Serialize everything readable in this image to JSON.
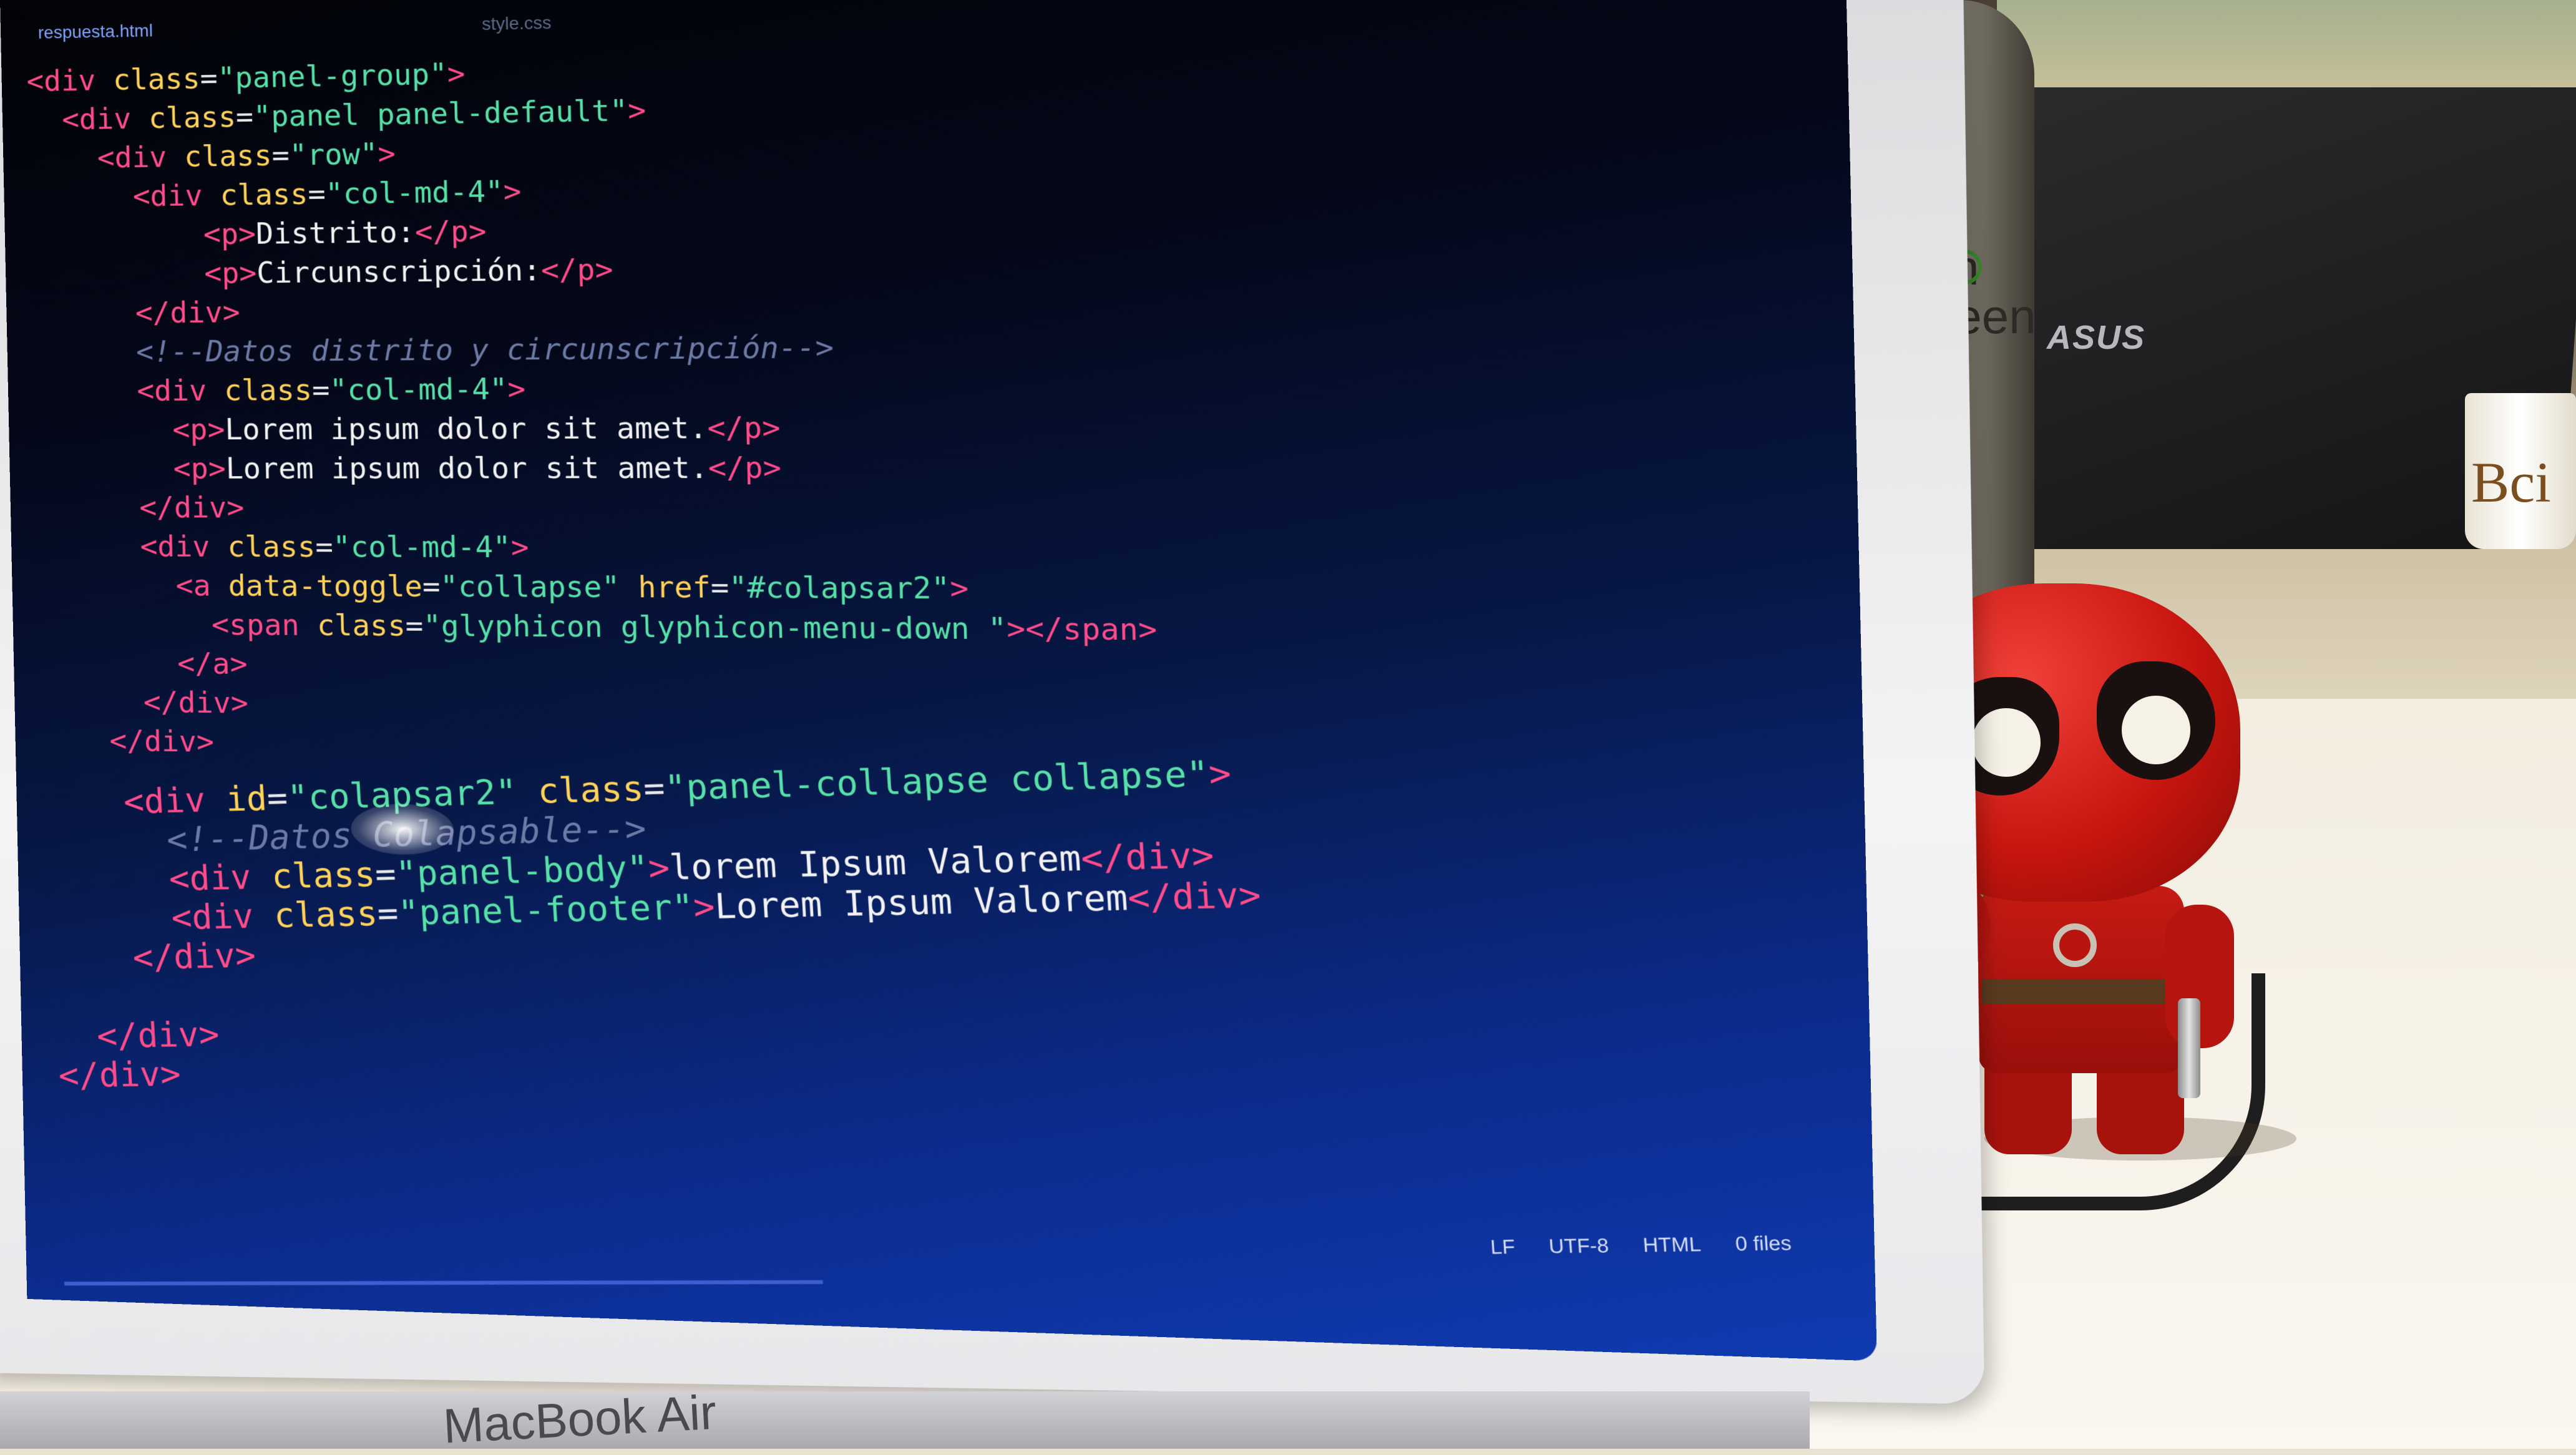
{
  "editor": {
    "tabs": [
      "respuesta.html",
      "style.css"
    ],
    "code_lines_upper": [
      {
        "indent": "",
        "parts": [
          [
            "tag",
            "<div "
          ],
          [
            "attr",
            "class"
          ],
          [
            "punct",
            "="
          ],
          [
            "str",
            "\"panel-group\""
          ],
          [
            "tag",
            ">"
          ]
        ]
      },
      {
        "indent": "  ",
        "parts": [
          [
            "tag",
            "<div "
          ],
          [
            "attr",
            "class"
          ],
          [
            "punct",
            "="
          ],
          [
            "str",
            "\"panel panel-default\""
          ],
          [
            "tag",
            ">"
          ]
        ]
      },
      {
        "indent": "    ",
        "parts": [
          [
            "tag",
            "<div "
          ],
          [
            "attr",
            "class"
          ],
          [
            "punct",
            "="
          ],
          [
            "str",
            "\"row\""
          ],
          [
            "tag",
            ">"
          ]
        ]
      },
      {
        "indent": "      ",
        "parts": [
          [
            "tag",
            "<div "
          ],
          [
            "attr",
            "class"
          ],
          [
            "punct",
            "="
          ],
          [
            "str",
            "\"col-md-4\""
          ],
          [
            "tag",
            ">"
          ]
        ]
      },
      {
        "indent": "          ",
        "parts": [
          [
            "tag",
            "<p>"
          ],
          [
            "txt",
            "Distrito:"
          ],
          [
            "tag",
            "</p>"
          ]
        ]
      },
      {
        "indent": "          ",
        "parts": [
          [
            "tag",
            "<p>"
          ],
          [
            "txt",
            "Circunscripción:"
          ],
          [
            "tag",
            "</p>"
          ]
        ]
      },
      {
        "indent": "      ",
        "parts": [
          [
            "tag",
            "</div>"
          ]
        ]
      },
      {
        "indent": "      ",
        "parts": [
          [
            "comment",
            "<!--Datos distrito y circunscripción-->"
          ]
        ]
      },
      {
        "indent": "      ",
        "parts": [
          [
            "tag",
            "<div "
          ],
          [
            "attr",
            "class"
          ],
          [
            "punct",
            "="
          ],
          [
            "str",
            "\"col-md-4\""
          ],
          [
            "tag",
            ">"
          ]
        ]
      },
      {
        "indent": "        ",
        "parts": [
          [
            "tag",
            "<p>"
          ],
          [
            "txt",
            "Lorem ipsum dolor sit amet."
          ],
          [
            "tag",
            "</p>"
          ]
        ]
      },
      {
        "indent": "        ",
        "parts": [
          [
            "tag",
            "<p>"
          ],
          [
            "txt",
            "Lorem ipsum dolor sit amet."
          ],
          [
            "tag",
            "</p>"
          ]
        ]
      },
      {
        "indent": "      ",
        "parts": [
          [
            "tag",
            "</div>"
          ]
        ]
      },
      {
        "indent": "      ",
        "parts": [
          [
            "tag",
            "<div "
          ],
          [
            "attr",
            "class"
          ],
          [
            "punct",
            "="
          ],
          [
            "str",
            "\"col-md-4\""
          ],
          [
            "tag",
            ">"
          ]
        ]
      },
      {
        "indent": "        ",
        "parts": [
          [
            "tag",
            "<a "
          ],
          [
            "attr",
            "data-toggle"
          ],
          [
            "punct",
            "="
          ],
          [
            "str",
            "\"collapse\""
          ],
          [
            "txt",
            " "
          ],
          [
            "attr",
            "href"
          ],
          [
            "punct",
            "="
          ],
          [
            "str",
            "\"#colapsar2\""
          ],
          [
            "tag",
            ">"
          ]
        ]
      },
      {
        "indent": "          ",
        "parts": [
          [
            "tag",
            "<span "
          ],
          [
            "attr",
            "class"
          ],
          [
            "punct",
            "="
          ],
          [
            "str",
            "\"glyphicon glyphicon-menu-down \""
          ],
          [
            "tag",
            "></span>"
          ]
        ]
      },
      {
        "indent": "        ",
        "parts": [
          [
            "tag",
            "</a>"
          ]
        ]
      },
      {
        "indent": "      ",
        "parts": [
          [
            "tag",
            "</div>"
          ]
        ]
      },
      {
        "indent": "    ",
        "parts": [
          [
            "tag",
            "</div>"
          ]
        ]
      }
    ],
    "code_lines_lower": [
      {
        "indent": "    ",
        "parts": [
          [
            "tag",
            "<div "
          ],
          [
            "attr",
            "id"
          ],
          [
            "punct",
            "="
          ],
          [
            "str",
            "\"colapsar2\""
          ],
          [
            "txt",
            " "
          ],
          [
            "attr",
            "class"
          ],
          [
            "punct",
            "="
          ],
          [
            "str",
            "\"panel-collapse collapse\""
          ],
          [
            "tag",
            ">"
          ]
        ]
      },
      {
        "indent": "      ",
        "parts": [
          [
            "comment",
            "<!--Datos Colapsable-->"
          ]
        ]
      },
      {
        "indent": "      ",
        "parts": [
          [
            "tag",
            "<div "
          ],
          [
            "attr",
            "class"
          ],
          [
            "punct",
            "="
          ],
          [
            "str",
            "\"panel-body\""
          ],
          [
            "tag",
            ">"
          ],
          [
            "txt",
            "lorem Ipsum Valorem"
          ],
          [
            "tag",
            "</div>"
          ]
        ]
      },
      {
        "indent": "      ",
        "parts": [
          [
            "tag",
            "<div "
          ],
          [
            "attr",
            "class"
          ],
          [
            "punct",
            "="
          ],
          [
            "str",
            "\"panel-footer\""
          ],
          [
            "tag",
            ">"
          ],
          [
            "txt",
            "Lorem Ipsum Valorem"
          ],
          [
            "tag",
            "</div>"
          ]
        ]
      },
      {
        "indent": "    ",
        "parts": [
          [
            "tag",
            "</div>"
          ]
        ]
      },
      {
        "indent": "",
        "parts": []
      },
      {
        "indent": "  ",
        "parts": [
          [
            "tag",
            "</div>"
          ]
        ]
      },
      {
        "indent": "",
        "parts": [
          [
            "tag",
            "</div>"
          ]
        ]
      }
    ],
    "status_bar": [
      "LF",
      "UTF-8",
      "HTML",
      "0 files"
    ]
  },
  "scene": {
    "laptop_label": "MacBook Air",
    "bottle_brand": "klean kanteen",
    "asus_logo": "ASUS",
    "cup_text": "Bci"
  }
}
